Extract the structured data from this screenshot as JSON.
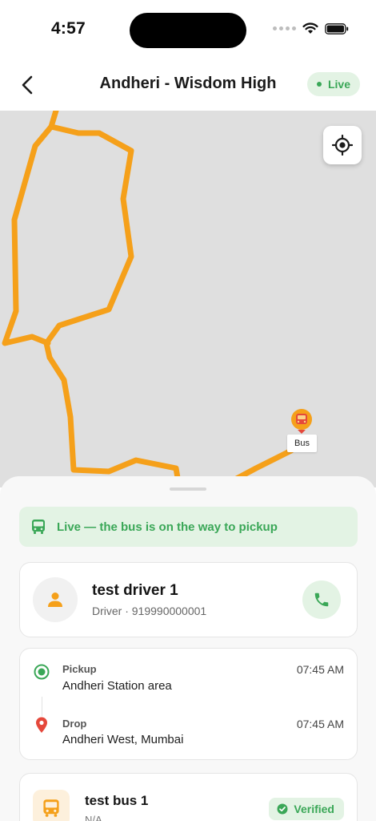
{
  "status_bar": {
    "time": "4:57"
  },
  "header": {
    "title": "Andheri - Wisdom High",
    "live_label": "Live"
  },
  "map": {
    "bus_label": "Bus",
    "route_color": "#F5A01A"
  },
  "banner": {
    "text": "Live — the bus is on the way to pickup"
  },
  "driver": {
    "name": "test driver 1",
    "subtitle": "Driver · 919990000001"
  },
  "route": {
    "pickup": {
      "kind": "Pickup",
      "place": "Andheri Station area",
      "time": "07:45 AM"
    },
    "drop": {
      "kind": "Drop",
      "place": "Andheri West, Mumbai",
      "time": "07:45 AM"
    }
  },
  "bus": {
    "name": "test bus 1",
    "subtitle": "N/A",
    "verified_label": "Verified"
  },
  "colors": {
    "accent_green": "#3AA757",
    "accent_orange": "#F5A01A",
    "drop_red": "#E5483B"
  }
}
